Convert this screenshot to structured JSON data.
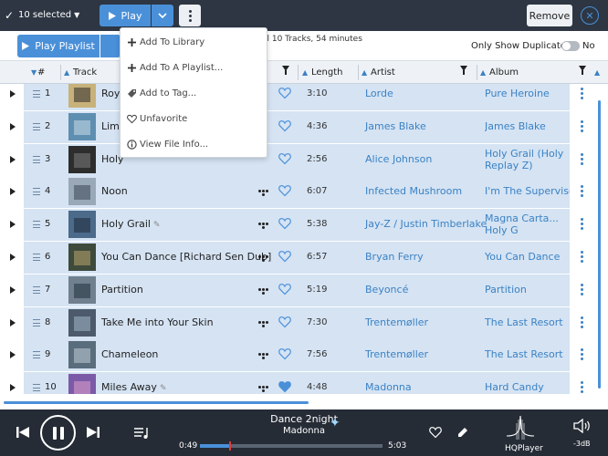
{
  "topbar": {
    "selection": "10 selected",
    "play_label": "Play",
    "remove_label": "Remove"
  },
  "toolbar": {
    "play_playlist_label": "Play Playlist",
    "track_info": "ll 10 Tracks, 54 minutes",
    "duplicates_label": "Only Show Duplicates",
    "duplicates_state": "No"
  },
  "columns": {
    "num": "#",
    "track": "Track",
    "length": "Length",
    "artist": "Artist",
    "album": "Album"
  },
  "menu": {
    "items": [
      {
        "label": "Add To Library",
        "icon": "plus-icon"
      },
      {
        "label": "Add To A Playlist...",
        "icon": "plus-icon"
      },
      {
        "label": "Add to Tag...",
        "icon": "tag-icon"
      },
      {
        "label": "Unfavorite",
        "icon": "heart-outline-icon"
      },
      {
        "label": "View File Info...",
        "icon": "info-icon"
      }
    ]
  },
  "tracks": [
    {
      "num": "1",
      "title": "Royals",
      "length": "3:10",
      "artist": "Lorde",
      "album": "Pure Heroine",
      "favorite": false
    },
    {
      "num": "2",
      "title": "Limit To Your Love",
      "length": "4:36",
      "artist": "James Blake",
      "album": "James Blake",
      "favorite": false
    },
    {
      "num": "3",
      "title": "Holy",
      "length": "2:56",
      "artist": "Alice Johnson",
      "album": "Holy Grail (Holy Replay Z)",
      "favorite": false
    },
    {
      "num": "4",
      "title": "Noon",
      "length": "6:07",
      "artist": "Infected Mushroom",
      "album": "I'm The Supervisor",
      "favorite": false
    },
    {
      "num": "5",
      "title": "Holy Grail",
      "length": "5:38",
      "artist": "Jay-Z / Justin Timberlake",
      "album": "Magna Carta... Holy G",
      "favorite": false
    },
    {
      "num": "6",
      "title": "You Can Dance [Richard Sen Dub]",
      "length": "6:57",
      "artist": "Bryan Ferry",
      "album": "You Can Dance",
      "favorite": false
    },
    {
      "num": "7",
      "title": "Partition",
      "length": "5:19",
      "artist": "Beyoncé",
      "album": "Partition",
      "favorite": false
    },
    {
      "num": "8",
      "title": "Take Me into Your Skin",
      "length": "7:30",
      "artist": "Trentemøller",
      "album": "The Last Resort",
      "favorite": false
    },
    {
      "num": "9",
      "title": "Chameleon",
      "length": "7:56",
      "artist": "Trentemøller",
      "album": "The Last Resort",
      "favorite": false
    },
    {
      "num": "10",
      "title": "Miles Away",
      "length": "4:48",
      "artist": "Madonna",
      "album": "Hard Candy",
      "favorite": true
    }
  ],
  "player": {
    "title": "Dance 2night",
    "artist": "Madonna",
    "elapsed": "0:49",
    "total": "5:03",
    "progress": 0.16,
    "hq_label": "HQPlayer",
    "volume": "-3dB"
  },
  "colors": {
    "accent": "#4a90d9",
    "link": "#3b82c4",
    "selected_row": "#d5e3f3",
    "bar_dark": "#2d3642"
  }
}
